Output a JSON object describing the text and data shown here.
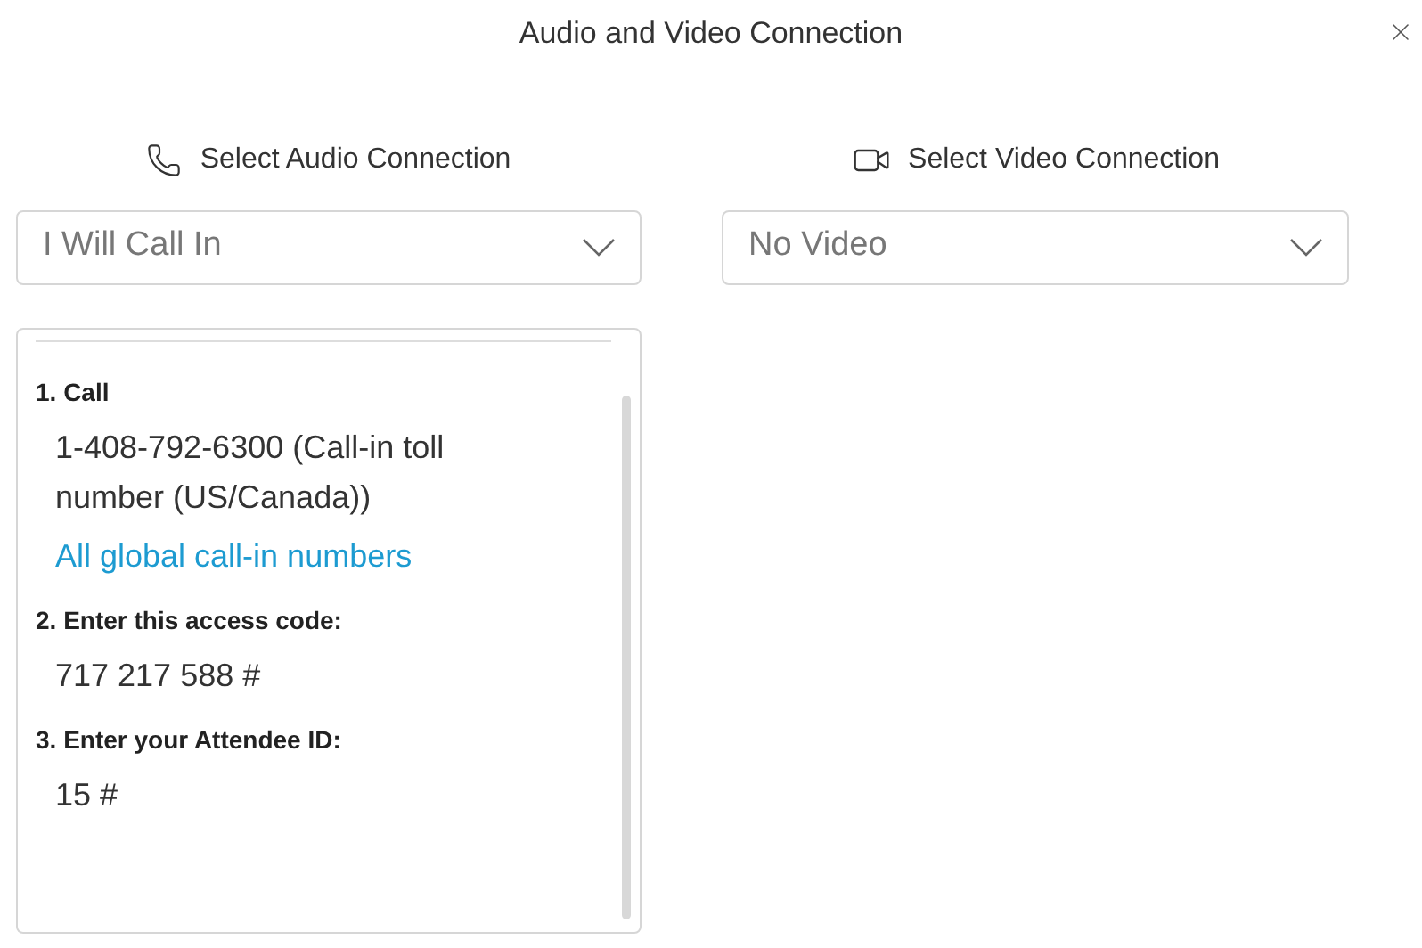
{
  "window": {
    "title": "Audio and Video Connection"
  },
  "audio": {
    "label": "Select Audio Connection",
    "value": "I Will Call In"
  },
  "video": {
    "label": "Select Video Connection",
    "value": "No Video"
  },
  "steps": [
    {
      "title": "1. Call",
      "lines": [
        {
          "kind": "text",
          "text": "1-408-792-6300 (Call-in toll number (US/Canada))"
        },
        {
          "kind": "link",
          "text": "All global call-in numbers"
        }
      ]
    },
    {
      "title": "2. Enter this access code:",
      "lines": [
        {
          "kind": "text",
          "text": "717 217 588 #"
        }
      ]
    },
    {
      "title": "3. Enter your Attendee ID:",
      "lines": [
        {
          "kind": "text",
          "text": "15 #"
        }
      ]
    }
  ]
}
